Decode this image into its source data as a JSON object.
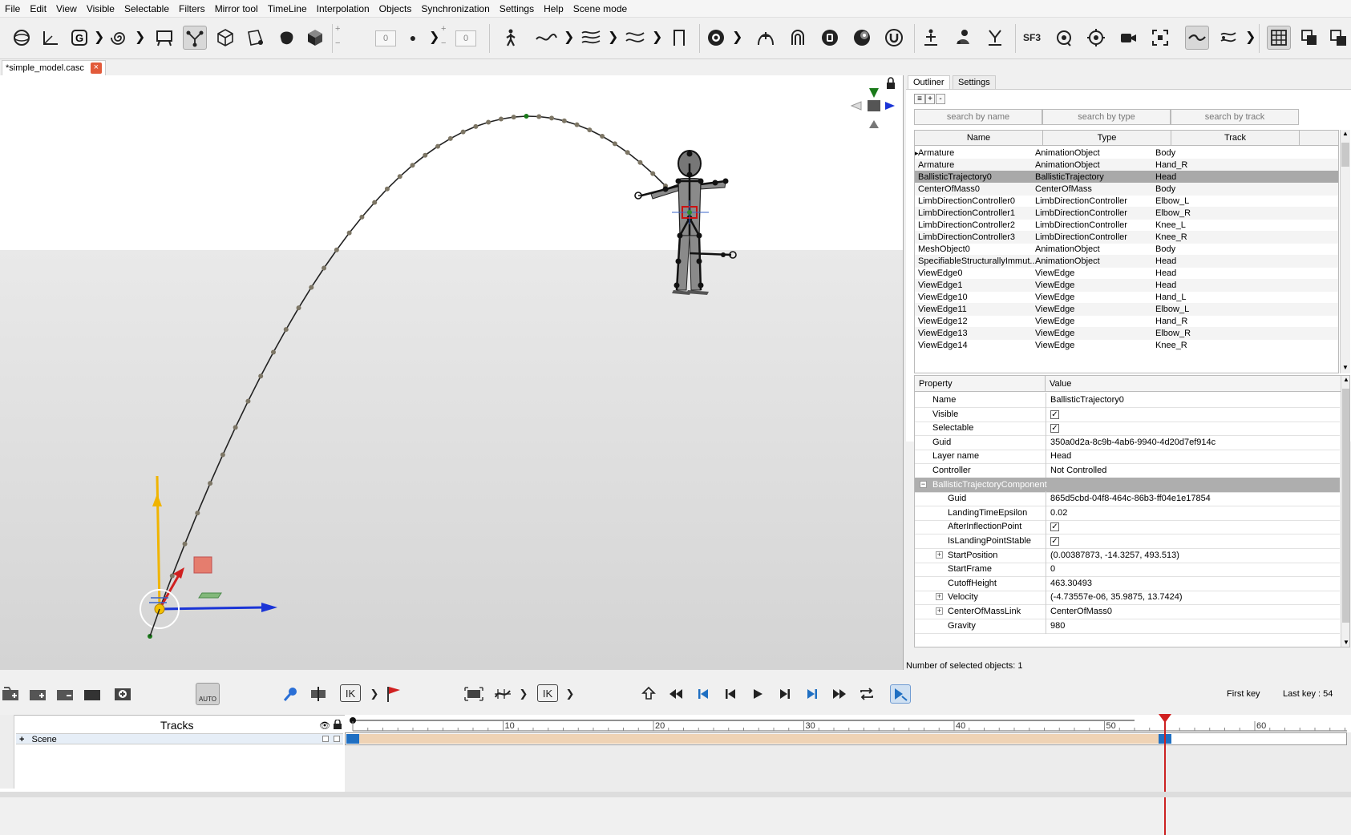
{
  "menu": [
    "File",
    "Edit",
    "View",
    "Visible",
    "Selectable",
    "Filters",
    "Mirror tool",
    "TimeLine",
    "Interpolation",
    "Objects",
    "Synchronization",
    "Settings",
    "Help",
    "Scene mode"
  ],
  "toolbar": {
    "spin1": "0",
    "spin2": "0",
    "plus": "+",
    "minus": "−",
    "sf3_label": "SF3",
    "icons": [
      "sphere-icon",
      "axes-icon",
      "g-icon",
      "spiral-icon",
      "frame-icon",
      "vertex-select-icon",
      "cube-wire-icon",
      "box-edit-icon",
      "blob-icon",
      "cube-solid-icon",
      "dot-icon",
      "walk-icon",
      "curve-icon",
      "curve-multi-icon",
      "curve-wave-icon",
      "bracket-icon",
      "camera-record-icon",
      "arc-up-icon",
      "arc-loop-icon",
      "stop-circle-icon",
      "double-circle-icon",
      "magnet-icon",
      "pin-figure-icon",
      "pair-figure-icon",
      "root-figure-icon",
      "sf3-icon",
      "target-rotate-icon",
      "crosshair-icon",
      "camera-icon",
      "focus-frame-icon",
      "wave-toggle-icon",
      "branch-icon",
      "grid-icon",
      "layout-split-icon",
      "layout-alt-icon"
    ]
  },
  "document": {
    "tab_title": "*simple_model.casc",
    "close_glyph": "×"
  },
  "right_panel": {
    "tabs": [
      "Outliner",
      "Settings"
    ],
    "outliner_buttons": [
      "≡",
      "+",
      "-"
    ],
    "search": {
      "name": "search by name",
      "type": "search by type",
      "track": "search by track"
    },
    "columns": [
      "Name",
      "Type",
      "Track"
    ],
    "rows": [
      {
        "name": "Armature",
        "type": "AnimationObject",
        "track": "Body"
      },
      {
        "name": "Armature",
        "type": "AnimationObject",
        "track": "Hand_R"
      },
      {
        "name": "BallisticTrajectory0",
        "type": "BallisticTrajectory",
        "track": "Head"
      },
      {
        "name": "CenterOfMass0",
        "type": "CenterOfMass",
        "track": "Body"
      },
      {
        "name": "LimbDirectionController0",
        "type": "LimbDirectionController",
        "track": "Elbow_L"
      },
      {
        "name": "LimbDirectionController1",
        "type": "LimbDirectionController",
        "track": "Elbow_R"
      },
      {
        "name": "LimbDirectionController2",
        "type": "LimbDirectionController",
        "track": "Knee_L"
      },
      {
        "name": "LimbDirectionController3",
        "type": "LimbDirectionController",
        "track": "Knee_R"
      },
      {
        "name": "MeshObject0",
        "type": "AnimationObject",
        "track": "Body"
      },
      {
        "name": "SpecifiableStructurallyImmut...",
        "type": "AnimationObject",
        "track": "Head"
      },
      {
        "name": "ViewEdge0",
        "type": "ViewEdge",
        "track": "Head"
      },
      {
        "name": "ViewEdge1",
        "type": "ViewEdge",
        "track": "Head"
      },
      {
        "name": "ViewEdge10",
        "type": "ViewEdge",
        "track": "Hand_L"
      },
      {
        "name": "ViewEdge11",
        "type": "ViewEdge",
        "track": "Elbow_L"
      },
      {
        "name": "ViewEdge12",
        "type": "ViewEdge",
        "track": "Hand_R"
      },
      {
        "name": "ViewEdge13",
        "type": "ViewEdge",
        "track": "Elbow_R"
      },
      {
        "name": "ViewEdge14",
        "type": "ViewEdge",
        "track": "Knee_R"
      }
    ],
    "selected_row": 2,
    "properties": {
      "col_property": "Property",
      "col_value": "Value",
      "rows": [
        {
          "name": "Name",
          "value": "BallisticTrajectory0",
          "kind": "text",
          "indent": 1
        },
        {
          "name": "Visible",
          "value": "✓",
          "kind": "check",
          "indent": 1
        },
        {
          "name": "Selectable",
          "value": "✓",
          "kind": "check",
          "indent": 1
        },
        {
          "name": "Guid",
          "value": "350a0d2a-8c9b-4ab6-9940-4d20d7ef914c",
          "kind": "text",
          "indent": 1
        },
        {
          "name": "Layer name",
          "value": "Head",
          "kind": "text",
          "indent": 1
        },
        {
          "name": "Controller",
          "value": "Not Controlled",
          "kind": "text",
          "indent": 1
        },
        {
          "name": "BallisticTrajectoryComponent",
          "value": "",
          "kind": "group",
          "indent": 1
        },
        {
          "name": "Guid",
          "value": "865d5cbd-04f8-464c-86b3-ff04e1e17854",
          "kind": "text",
          "indent": 2
        },
        {
          "name": "LandingTimeEpsilon",
          "value": "0.02",
          "kind": "text",
          "indent": 2
        },
        {
          "name": "AfterInflectionPoint",
          "value": "✓",
          "kind": "check",
          "indent": 2
        },
        {
          "name": "IsLandingPointStable",
          "value": "✓",
          "kind": "check",
          "indent": 2
        },
        {
          "name": "StartPosition",
          "value": "(0.00387873, -14.3257, 493.513)",
          "kind": "expand",
          "indent": 2
        },
        {
          "name": "StartFrame",
          "value": "0",
          "kind": "text",
          "indent": 2
        },
        {
          "name": "CutoffHeight",
          "value": "463.30493",
          "kind": "text",
          "indent": 2
        },
        {
          "name": "Velocity",
          "value": "(-4.73557e-06, 35.9875, 13.7424)",
          "kind": "expand",
          "indent": 2
        },
        {
          "name": "CenterOfMassLink",
          "value": "CenterOfMass0",
          "kind": "expand",
          "indent": 2
        },
        {
          "name": "Gravity",
          "value": "980",
          "kind": "text",
          "indent": 2
        }
      ]
    }
  },
  "status": {
    "selected_text": "Number of selected objects: 1"
  },
  "playback": {
    "auto_label": "AUTO",
    "first_key": "First key",
    "last_key": "Last key : 54",
    "ik_label": "IK",
    "ik_label2": "IK"
  },
  "tracks": {
    "title": "Tracks",
    "scene_label": "Scene",
    "expand": "+"
  },
  "timeline": {
    "ticks": [
      "10",
      "20",
      "30",
      "40",
      "50",
      "60"
    ],
    "current_frame": 54,
    "last_key": 54,
    "max_frame": 66,
    "colors": {
      "track_fill": "#efd3b5",
      "playhead": "#d02020",
      "key": "#1f6fc2"
    }
  },
  "viewport": {
    "colors": {
      "trajectory": "#222222",
      "points": "#7d7665",
      "peak": "#1a7a1a",
      "x_axis": "#1a34d6",
      "y_axis": "#f0b400",
      "z_axis": "#d02020"
    }
  }
}
